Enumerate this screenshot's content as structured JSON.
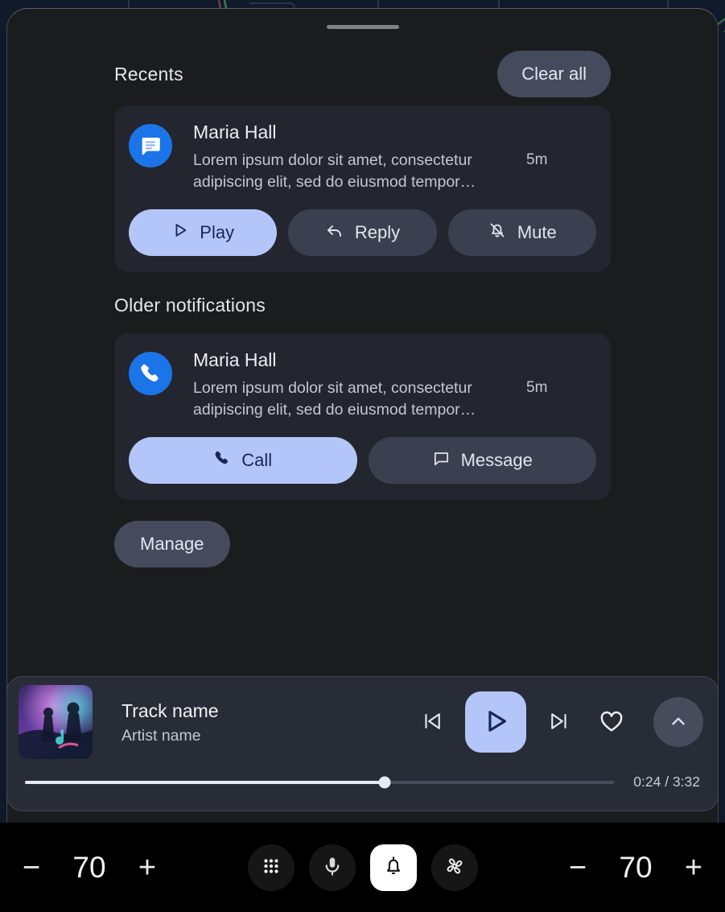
{
  "background": {
    "type": "map-navigation-dark"
  },
  "panel": {
    "drag_handle": "drag-handle",
    "recents": {
      "title": "Recents",
      "clear_all_label": "Clear all"
    },
    "older": {
      "title": "Older notifications"
    },
    "manage_label": "Manage",
    "notifications": [
      {
        "app_icon": "messages-icon",
        "title": "Maria Hall",
        "body": "Lorem ipsum dolor sit amet, consectetur adipiscing elit, sed do eiusmod tempor…",
        "time": "5m",
        "actions": [
          {
            "label": "Play",
            "icon": "play-icon",
            "style": "primary"
          },
          {
            "label": "Reply",
            "icon": "reply-icon",
            "style": "secondary"
          },
          {
            "label": "Mute",
            "icon": "bell-off-icon",
            "style": "secondary"
          }
        ]
      },
      {
        "app_icon": "phone-icon",
        "title": "Maria Hall",
        "body": "Lorem ipsum dolor sit amet, consectetur adipiscing elit, sed do eiusmod tempor…",
        "time": "5m",
        "actions": [
          {
            "label": "Call",
            "icon": "phone-icon",
            "style": "primary"
          },
          {
            "label": "Message",
            "icon": "message-icon",
            "style": "secondary"
          }
        ]
      }
    ]
  },
  "media": {
    "album_art": "concert-album-art",
    "track_name": "Track name",
    "artist_name": "Artist name",
    "controls": {
      "previous": "skip-previous-icon",
      "play": "play-icon",
      "next": "skip-next-icon",
      "favorite": "heart-icon",
      "expand": "chevron-up-icon"
    },
    "progress": {
      "elapsed": "0:24",
      "duration": "3:32",
      "time_label": "0:24 / 3:32",
      "percent": 61
    }
  },
  "bottom_bar": {
    "left_climate": {
      "decrease_label": "−",
      "value": "70",
      "increase_label": "+"
    },
    "right_climate": {
      "decrease_label": "−",
      "value": "70",
      "increase_label": "+"
    },
    "center_buttons": [
      {
        "icon": "apps-grid-icon",
        "active": false
      },
      {
        "icon": "microphone-icon",
        "active": false
      },
      {
        "icon": "bell-icon",
        "active": true
      },
      {
        "icon": "fan-icon",
        "active": false
      }
    ]
  },
  "colors": {
    "panel_bg": "#1a1c1e",
    "card_bg": "#23262e",
    "primary_accent": "#b4c6f9",
    "primary_on_accent": "#16265c",
    "secondary_btn": "#3b4050",
    "chip_btn": "#454a5c",
    "app_badge_blue": "#1b74e8",
    "media_bg": "#282c36"
  }
}
